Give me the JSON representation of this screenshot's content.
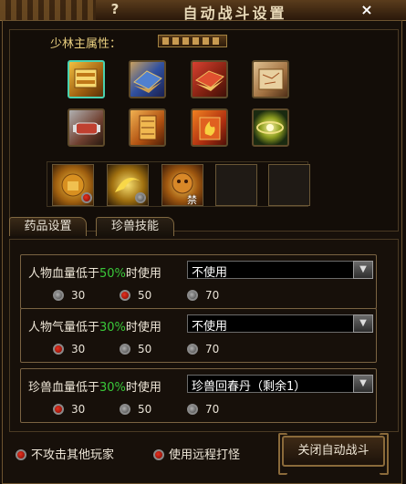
{
  "window": {
    "title": "自动战斗设置",
    "help_label": "?",
    "close_label": "×"
  },
  "attribute": {
    "label": "少林主属性："
  },
  "skills": [
    {
      "icon": "gold-book-icon",
      "selected": true
    },
    {
      "icon": "blue-book-icon",
      "selected": false
    },
    {
      "icon": "red-book-icon",
      "selected": false
    },
    {
      "icon": "scroll-map-icon",
      "selected": false
    },
    {
      "icon": "bound-scroll-icon",
      "selected": false
    },
    {
      "icon": "stacked-books-icon",
      "selected": false
    },
    {
      "icon": "flame-book-icon",
      "selected": false
    },
    {
      "icon": "golden-vortex-icon",
      "selected": false
    }
  ],
  "slots": [
    {
      "icon": "golden-fist-icon",
      "marker": "red"
    },
    {
      "icon": "golden-swirl-icon",
      "marker": "grey"
    },
    {
      "icon": "golden-beast-icon",
      "badge": "禁"
    },
    {
      "icon": "empty-slot"
    },
    {
      "icon": "empty-slot"
    }
  ],
  "tabs": [
    {
      "label": "药品设置",
      "active": true
    },
    {
      "label": "珍兽技能",
      "active": false
    }
  ],
  "rows": [
    {
      "prefix": "人物血量低于",
      "percent": "50%",
      "suffix": "时使用",
      "select_value": "不使用",
      "options": [
        {
          "label": "30",
          "active": false
        },
        {
          "label": "50",
          "active": true
        },
        {
          "label": "70",
          "active": false
        }
      ]
    },
    {
      "prefix": "人物气量低于",
      "percent": "30%",
      "suffix": "时使用",
      "select_value": "不使用",
      "options": [
        {
          "label": "30",
          "active": true
        },
        {
          "label": "50",
          "active": false
        },
        {
          "label": "70",
          "active": false
        }
      ]
    },
    {
      "prefix": "珍兽血量低于",
      "percent": "30%",
      "suffix": "时使用",
      "select_value": "珍兽回春丹（剩余1）",
      "options": [
        {
          "label": "30",
          "active": true
        },
        {
          "label": "50",
          "active": false
        },
        {
          "label": "70",
          "active": false
        }
      ]
    }
  ],
  "bottom": {
    "no_attack_label": "不攻击其他玩家",
    "ranged_label": "使用远程打怪",
    "close_button": "关闭自动战斗"
  },
  "colors": {
    "percent_green": "#3ac83a",
    "selected_border": "#48d2b0",
    "frame_gold": "#8a6a3a"
  }
}
